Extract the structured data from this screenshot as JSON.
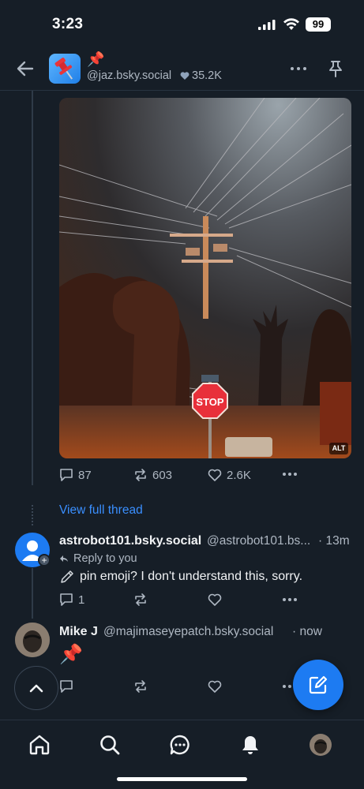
{
  "status_bar": {
    "time": "3:23",
    "battery": "99"
  },
  "header": {
    "emoji": "📌",
    "handle": "@jaz.bsky.social",
    "followers": "35.2K"
  },
  "post": {
    "image_alt_badge": "ALT",
    "replies": "87",
    "reposts": "603",
    "likes": "2.6K"
  },
  "view_full_thread": "View full thread",
  "reply1": {
    "name": "astrobot101.bsky.social",
    "handle": "@astrobot101.bs...",
    "time": "· 13m",
    "reply_to": "Reply to you",
    "text": "pin emoji?   I don't understand this, sorry.",
    "replies": "1"
  },
  "reply2": {
    "name": "Mike J",
    "handle": "@majimaseyepatch.bsky.social",
    "time": "· now",
    "text": "📌"
  },
  "icons": {
    "back": "arrow-left-icon",
    "pin": "pin-icon",
    "more": "more-dots-icon",
    "compose": "compose-icon",
    "home": "home-icon",
    "search": "search-icon",
    "chat": "chat-icon",
    "notifications": "bell-icon"
  },
  "colors": {
    "accent": "#1d7bf2",
    "link": "#3a8fff",
    "background": "#161e27"
  }
}
